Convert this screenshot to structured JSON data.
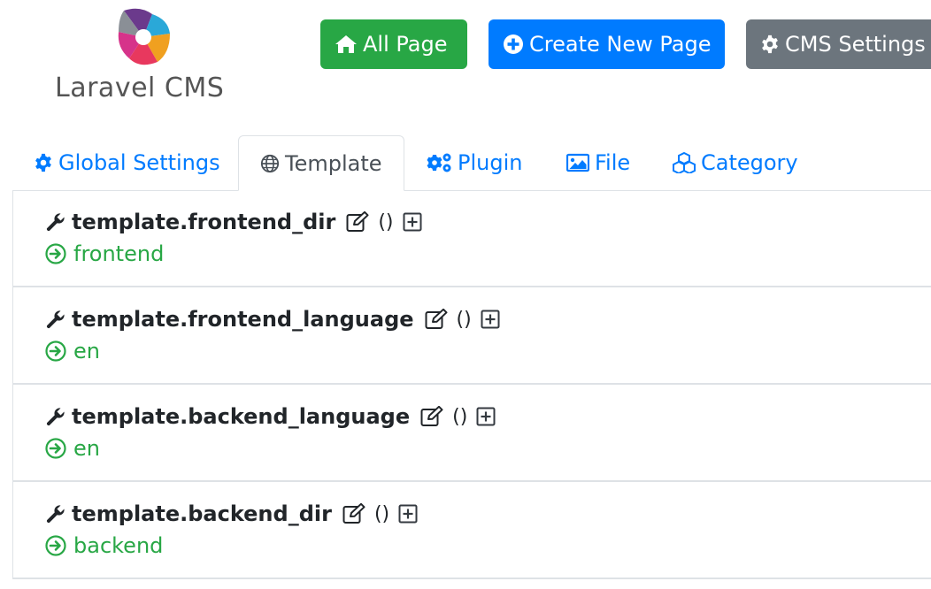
{
  "brand": {
    "name": "Laravel CMS"
  },
  "toolbar": {
    "all_page_label": "All Page",
    "create_label": "Create New Page",
    "settings_label": "CMS Settings"
  },
  "tabs": [
    {
      "label": "Global Settings",
      "icon": "gear-icon",
      "active": false
    },
    {
      "label": "Template",
      "icon": "globe-icon",
      "active": true
    },
    {
      "label": "Plugin",
      "icon": "cogs-icon",
      "active": false
    },
    {
      "label": "File",
      "icon": "image-icon",
      "active": false
    },
    {
      "label": "Category",
      "icon": "cubes-icon",
      "active": false
    }
  ],
  "settings": [
    {
      "key": "template.frontend_dir",
      "extra": "()",
      "value": "frontend"
    },
    {
      "key": "template.frontend_language",
      "extra": "()",
      "value": "en"
    },
    {
      "key": "template.backend_language",
      "extra": "()",
      "value": "en"
    },
    {
      "key": "template.backend_dir",
      "extra": "()",
      "value": "backend"
    }
  ],
  "colors": {
    "green": "#28a745",
    "blue": "#007bff",
    "gray": "#6c757d",
    "link": "#007bff"
  }
}
